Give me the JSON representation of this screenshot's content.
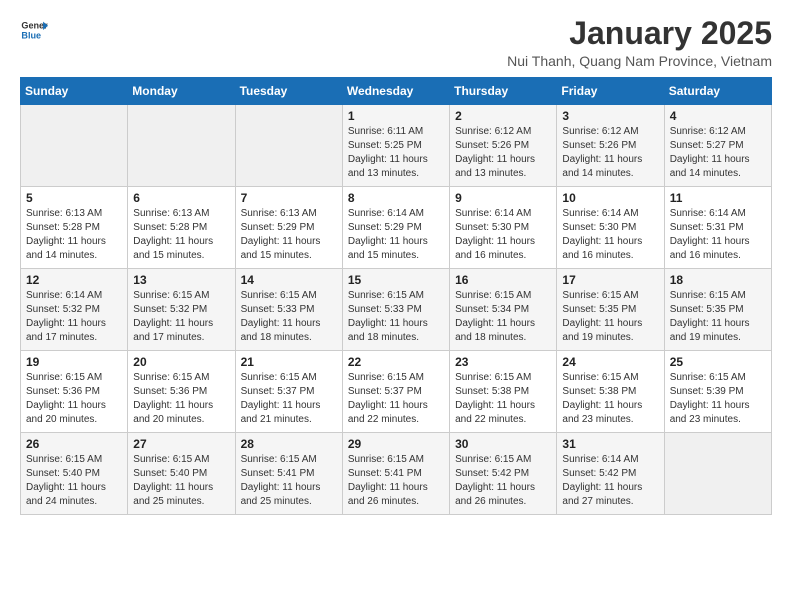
{
  "header": {
    "logo_general": "General",
    "logo_blue": "Blue",
    "month_title": "January 2025",
    "location": "Nui Thanh, Quang Nam Province, Vietnam"
  },
  "weekdays": [
    "Sunday",
    "Monday",
    "Tuesday",
    "Wednesday",
    "Thursday",
    "Friday",
    "Saturday"
  ],
  "weeks": [
    [
      {
        "day": "",
        "info": ""
      },
      {
        "day": "",
        "info": ""
      },
      {
        "day": "",
        "info": ""
      },
      {
        "day": "1",
        "info": "Sunrise: 6:11 AM\nSunset: 5:25 PM\nDaylight: 11 hours and 13 minutes."
      },
      {
        "day": "2",
        "info": "Sunrise: 6:12 AM\nSunset: 5:26 PM\nDaylight: 11 hours and 13 minutes."
      },
      {
        "day": "3",
        "info": "Sunrise: 6:12 AM\nSunset: 5:26 PM\nDaylight: 11 hours and 14 minutes."
      },
      {
        "day": "4",
        "info": "Sunrise: 6:12 AM\nSunset: 5:27 PM\nDaylight: 11 hours and 14 minutes."
      }
    ],
    [
      {
        "day": "5",
        "info": "Sunrise: 6:13 AM\nSunset: 5:28 PM\nDaylight: 11 hours and 14 minutes."
      },
      {
        "day": "6",
        "info": "Sunrise: 6:13 AM\nSunset: 5:28 PM\nDaylight: 11 hours and 15 minutes."
      },
      {
        "day": "7",
        "info": "Sunrise: 6:13 AM\nSunset: 5:29 PM\nDaylight: 11 hours and 15 minutes."
      },
      {
        "day": "8",
        "info": "Sunrise: 6:14 AM\nSunset: 5:29 PM\nDaylight: 11 hours and 15 minutes."
      },
      {
        "day": "9",
        "info": "Sunrise: 6:14 AM\nSunset: 5:30 PM\nDaylight: 11 hours and 16 minutes."
      },
      {
        "day": "10",
        "info": "Sunrise: 6:14 AM\nSunset: 5:30 PM\nDaylight: 11 hours and 16 minutes."
      },
      {
        "day": "11",
        "info": "Sunrise: 6:14 AM\nSunset: 5:31 PM\nDaylight: 11 hours and 16 minutes."
      }
    ],
    [
      {
        "day": "12",
        "info": "Sunrise: 6:14 AM\nSunset: 5:32 PM\nDaylight: 11 hours and 17 minutes."
      },
      {
        "day": "13",
        "info": "Sunrise: 6:15 AM\nSunset: 5:32 PM\nDaylight: 11 hours and 17 minutes."
      },
      {
        "day": "14",
        "info": "Sunrise: 6:15 AM\nSunset: 5:33 PM\nDaylight: 11 hours and 18 minutes."
      },
      {
        "day": "15",
        "info": "Sunrise: 6:15 AM\nSunset: 5:33 PM\nDaylight: 11 hours and 18 minutes."
      },
      {
        "day": "16",
        "info": "Sunrise: 6:15 AM\nSunset: 5:34 PM\nDaylight: 11 hours and 18 minutes."
      },
      {
        "day": "17",
        "info": "Sunrise: 6:15 AM\nSunset: 5:35 PM\nDaylight: 11 hours and 19 minutes."
      },
      {
        "day": "18",
        "info": "Sunrise: 6:15 AM\nSunset: 5:35 PM\nDaylight: 11 hours and 19 minutes."
      }
    ],
    [
      {
        "day": "19",
        "info": "Sunrise: 6:15 AM\nSunset: 5:36 PM\nDaylight: 11 hours and 20 minutes."
      },
      {
        "day": "20",
        "info": "Sunrise: 6:15 AM\nSunset: 5:36 PM\nDaylight: 11 hours and 20 minutes."
      },
      {
        "day": "21",
        "info": "Sunrise: 6:15 AM\nSunset: 5:37 PM\nDaylight: 11 hours and 21 minutes."
      },
      {
        "day": "22",
        "info": "Sunrise: 6:15 AM\nSunset: 5:37 PM\nDaylight: 11 hours and 22 minutes."
      },
      {
        "day": "23",
        "info": "Sunrise: 6:15 AM\nSunset: 5:38 PM\nDaylight: 11 hours and 22 minutes."
      },
      {
        "day": "24",
        "info": "Sunrise: 6:15 AM\nSunset: 5:38 PM\nDaylight: 11 hours and 23 minutes."
      },
      {
        "day": "25",
        "info": "Sunrise: 6:15 AM\nSunset: 5:39 PM\nDaylight: 11 hours and 23 minutes."
      }
    ],
    [
      {
        "day": "26",
        "info": "Sunrise: 6:15 AM\nSunset: 5:40 PM\nDaylight: 11 hours and 24 minutes."
      },
      {
        "day": "27",
        "info": "Sunrise: 6:15 AM\nSunset: 5:40 PM\nDaylight: 11 hours and 25 minutes."
      },
      {
        "day": "28",
        "info": "Sunrise: 6:15 AM\nSunset: 5:41 PM\nDaylight: 11 hours and 25 minutes."
      },
      {
        "day": "29",
        "info": "Sunrise: 6:15 AM\nSunset: 5:41 PM\nDaylight: 11 hours and 26 minutes."
      },
      {
        "day": "30",
        "info": "Sunrise: 6:15 AM\nSunset: 5:42 PM\nDaylight: 11 hours and 26 minutes."
      },
      {
        "day": "31",
        "info": "Sunrise: 6:14 AM\nSunset: 5:42 PM\nDaylight: 11 hours and 27 minutes."
      },
      {
        "day": "",
        "info": ""
      }
    ]
  ]
}
